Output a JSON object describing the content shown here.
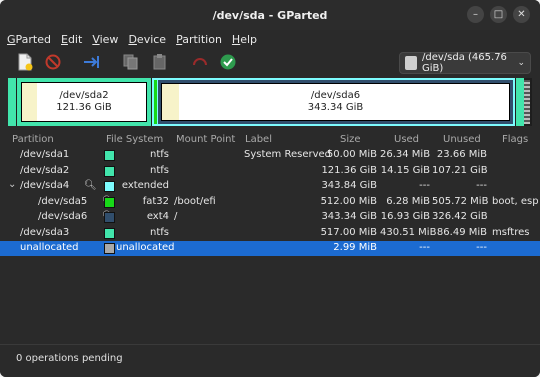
{
  "window": {
    "title": "/dev/sda - GParted",
    "minimize": "–",
    "maximize": "□",
    "close": "✕"
  },
  "menu": [
    {
      "label": "GParted",
      "accel": "G"
    },
    {
      "label": "Edit",
      "accel": "E"
    },
    {
      "label": "View",
      "accel": "V"
    },
    {
      "label": "Device",
      "accel": "D"
    },
    {
      "label": "Partition",
      "accel": "P"
    },
    {
      "label": "Help",
      "accel": "H"
    }
  ],
  "toolbar": {
    "icons": [
      "new-partition-icon",
      "delete-icon",
      "resize-move-icon",
      "copy-icon",
      "paste-icon",
      "undo-icon",
      "apply-icon"
    ],
    "device": "/dev/sda (465.76 GiB)"
  },
  "partition_map": {
    "sda2": {
      "name": "/dev/sda2",
      "size": "121.36 GiB",
      "used_fraction": 0.12
    },
    "sda6": {
      "name": "/dev/sda6",
      "size": "343.34 GiB",
      "used_fraction": 0.05
    }
  },
  "table": {
    "headers": {
      "partition": "Partition",
      "filesystem": "File System",
      "mount": "Mount Point",
      "label": "Label",
      "size": "Size",
      "used": "Used",
      "unused": "Unused",
      "flags": "Flags"
    },
    "rows": [
      {
        "partition": "/dev/sda1",
        "fs": "ntfs",
        "mount": "",
        "label": "System Reserved",
        "size": "50.00 MiB",
        "used": "26.34 MiB",
        "unused": "23.66 MiB",
        "flags": "",
        "color": "#42e5ac",
        "indent": 0,
        "key": false,
        "caret": false
      },
      {
        "partition": "/dev/sda2",
        "fs": "ntfs",
        "mount": "",
        "label": "",
        "size": "121.36 GiB",
        "used": "14.15 GiB",
        "unused": "107.21 GiB",
        "flags": "",
        "color": "#42e5ac",
        "indent": 0,
        "key": false,
        "caret": false
      },
      {
        "partition": "/dev/sda4",
        "fs": "extended",
        "mount": "",
        "label": "",
        "size": "343.84 GiB",
        "used": "---",
        "unused": "---",
        "flags": "",
        "color": "#7dfcfe",
        "indent": 0,
        "key": true,
        "caret": true
      },
      {
        "partition": "/dev/sda5",
        "fs": "fat32",
        "mount": "/boot/efi",
        "label": "",
        "size": "512.00 MiB",
        "used": "6.28 MiB",
        "unused": "505.72 MiB",
        "flags": "boot, esp",
        "color": "#18d918",
        "indent": 1,
        "key": true,
        "caret": false
      },
      {
        "partition": "/dev/sda6",
        "fs": "ext4",
        "mount": "/",
        "label": "",
        "size": "343.34 GiB",
        "used": "16.93 GiB",
        "unused": "326.42 GiB",
        "flags": "",
        "color": "#314e6c",
        "indent": 1,
        "key": true,
        "caret": false
      },
      {
        "partition": "/dev/sda3",
        "fs": "ntfs",
        "mount": "",
        "label": "",
        "size": "517.00 MiB",
        "used": "430.51 MiB",
        "unused": "86.49 MiB",
        "flags": "msftres",
        "color": "#42e5ac",
        "indent": 0,
        "key": false,
        "caret": false
      },
      {
        "partition": "unallocated",
        "fs": "unallocated",
        "mount": "",
        "label": "",
        "size": "2.99 MiB",
        "used": "---",
        "unused": "---",
        "flags": "",
        "color": "#a9a9a9",
        "indent": 0,
        "key": false,
        "caret": false,
        "selected": true
      }
    ]
  },
  "status": {
    "text": "0 operations pending"
  }
}
